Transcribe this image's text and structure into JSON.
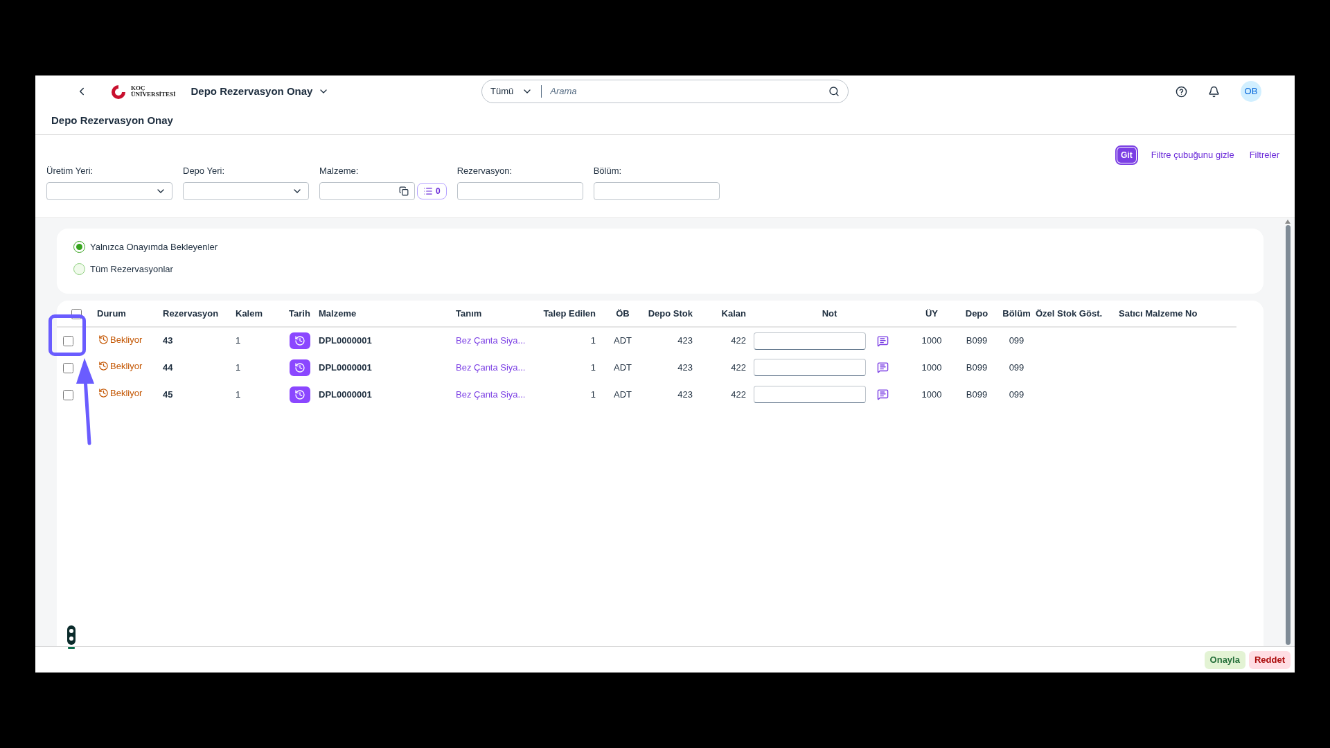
{
  "shell": {
    "app_title": "Depo Rezervasyon Onay",
    "logo_text": [
      "KOÇ",
      "ÜNİVERSİTESİ"
    ],
    "search": {
      "scope": "Tümü",
      "placeholder": "Arama"
    },
    "avatar": "OB"
  },
  "page_title": "Depo Rezervasyon Onay",
  "filter_bar": {
    "go": "Git",
    "hide": "Filtre çubuğunu gizle",
    "filters": "Filtreler",
    "fields": [
      {
        "label": "Üretim Yeri:",
        "kind": "select"
      },
      {
        "label": "Depo Yeri:",
        "kind": "select"
      },
      {
        "label": "Malzeme:",
        "kind": "multi",
        "count": "0"
      },
      {
        "label": "Rezervasyon:",
        "kind": "text"
      },
      {
        "label": "Bölüm:",
        "kind": "text"
      }
    ]
  },
  "options": [
    {
      "label": "Yalnızca Onayımda Bekleyenler",
      "selected": true
    },
    {
      "label": "Tüm Rezervasyonlar",
      "selected": false
    }
  ],
  "table": {
    "all_checked": false,
    "columns": [
      "Durum",
      "Rezervasyon",
      "Kalem",
      "Tarih",
      "Malzeme",
      "Tanım",
      "Talep Edilen",
      "ÖB",
      "Depo Stok",
      "Kalan",
      "Not",
      "ÜY",
      "Depo",
      "Bölüm",
      "Özel Stok Göst.",
      "Satıcı Malzeme No"
    ],
    "rows": [
      {
        "checked": false,
        "status": {
          "label": "Bekliyor",
          "kind": "pending"
        },
        "reservation": "43",
        "item": "1",
        "material": "DPL0000001",
        "description": "Bez Çanta Siya...",
        "requested": "1",
        "unit": "ADT",
        "stock": "423",
        "remaining": "422",
        "plant": "1000",
        "depot": "B099",
        "section": "099"
      },
      {
        "checked": false,
        "status": {
          "label": "Bekliyor",
          "kind": "pending"
        },
        "reservation": "44",
        "item": "1",
        "material": "DPL0000001",
        "description": "Bez Çanta Siya...",
        "requested": "1",
        "unit": "ADT",
        "stock": "423",
        "remaining": "422",
        "plant": "1000",
        "depot": "B099",
        "section": "099"
      },
      {
        "checked": false,
        "status": {
          "label": "Bekliyor",
          "kind": "pending"
        },
        "reservation": "45",
        "item": "1",
        "material": "DPL0000001",
        "description": "Bez Çanta Siya...",
        "requested": "1",
        "unit": "ADT",
        "stock": "423",
        "remaining": "422",
        "plant": "1000",
        "depot": "B099",
        "section": "099"
      }
    ]
  },
  "footer": {
    "buttons": [
      {
        "label": "Onayla",
        "kind": "accept"
      },
      {
        "label": "Reddet",
        "kind": "reject"
      }
    ]
  }
}
